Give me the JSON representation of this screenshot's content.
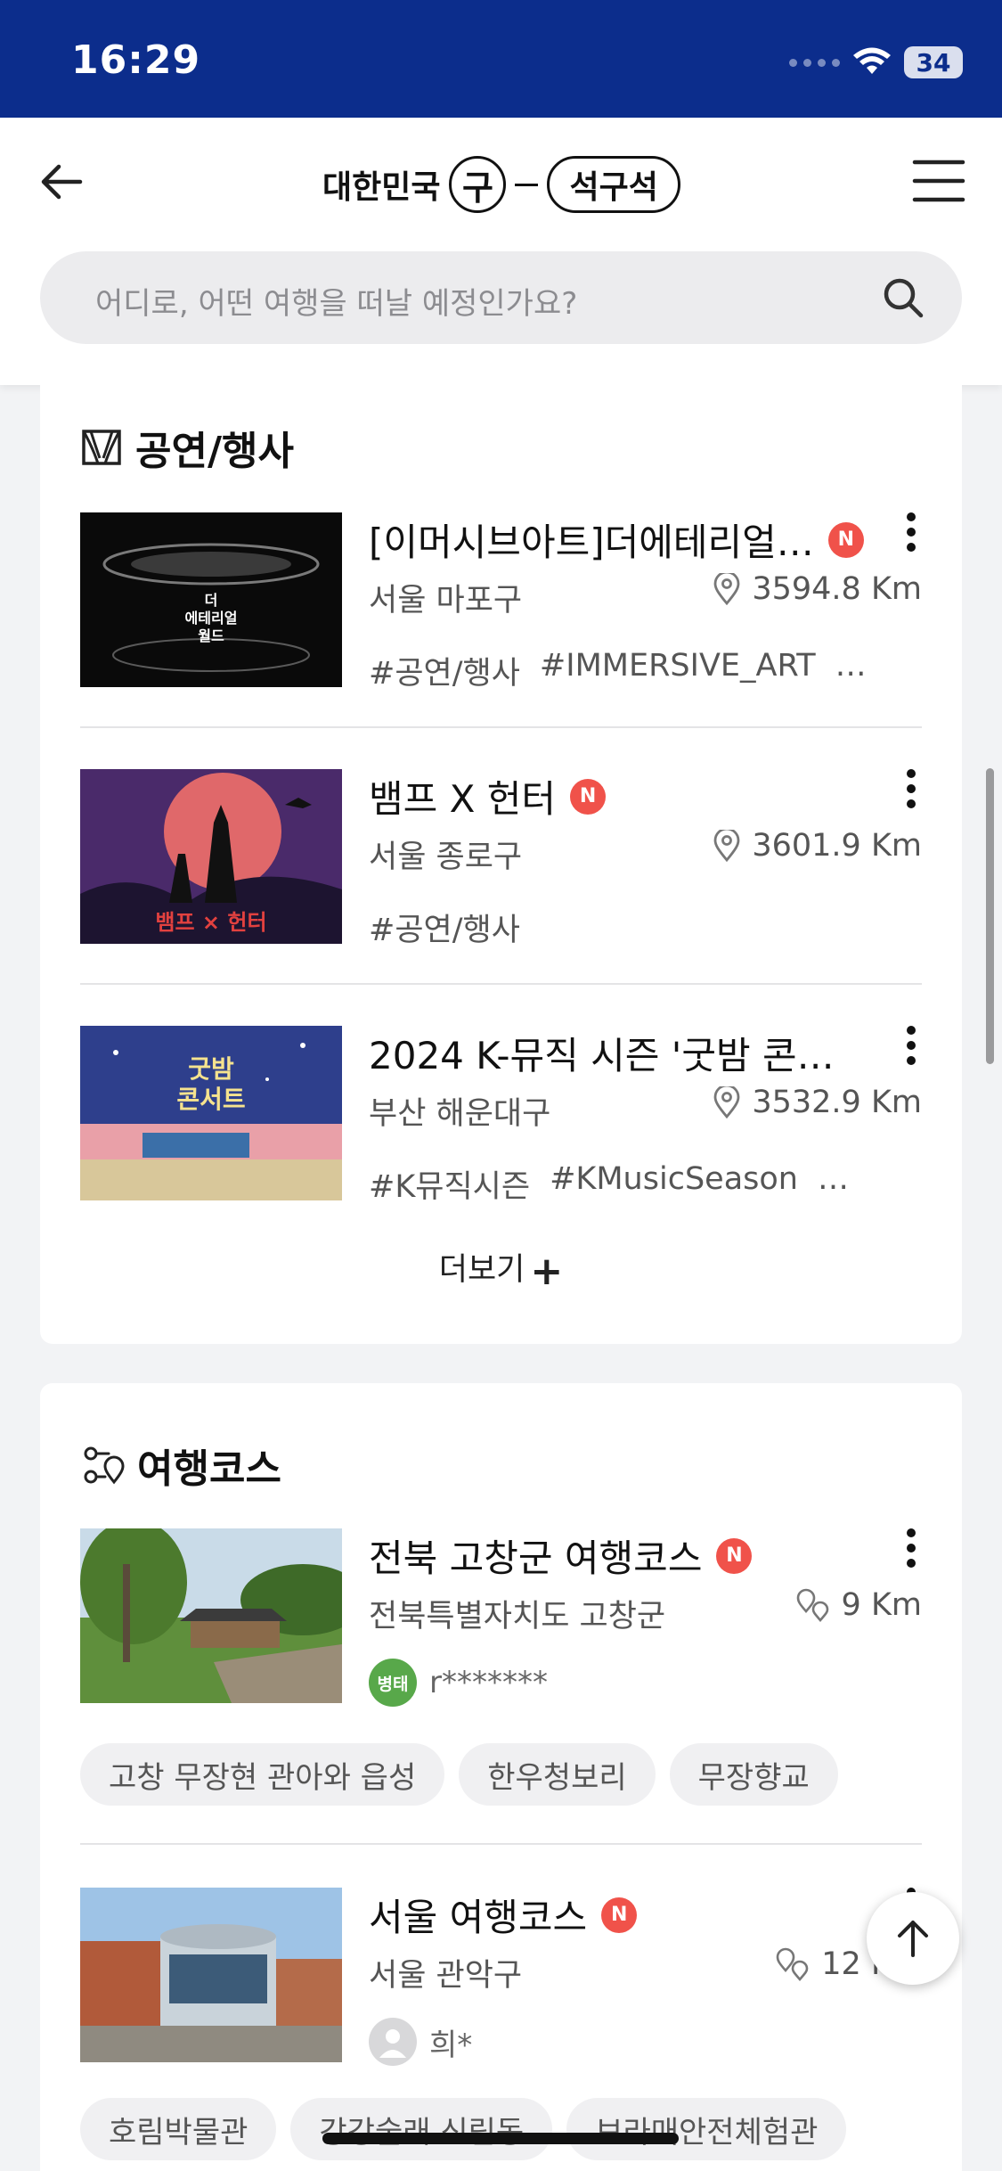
{
  "status_bar": {
    "time": "16:29",
    "battery": "34"
  },
  "header": {
    "logo_prefix": "대한민국",
    "logo_circle": "구",
    "logo_pill": "석구석",
    "search_placeholder": "어디로, 어떤 여행을 떠날 예정인가요?"
  },
  "events": {
    "title": "공연/행사",
    "items": [
      {
        "title": "[이머시브아트]더에테리얼…",
        "badge": "N",
        "location": "서울 마포구",
        "distance": "3594.8 Km",
        "tags": [
          "#공연/행사",
          "#IMMERSIVE_ART",
          "…"
        ],
        "thumb_text": "더\n에테리얼\n월드"
      },
      {
        "title": "뱀프 X 헌터",
        "badge": "N",
        "location": "서울 종로구",
        "distance": "3601.9 Km",
        "tags": [
          "#공연/행사"
        ],
        "thumb_text": "뱀프 × 헌터"
      },
      {
        "title": "2024 K-뮤직 시즌 '굿밤 콘서…",
        "badge": "",
        "location": "부산 해운대구",
        "distance": "3532.9 Km",
        "tags": [
          "#K뮤직시즌",
          "#KMusicSeason",
          "…"
        ],
        "thumb_text": "굿밤\n콘서트"
      }
    ],
    "more_label": "더보기",
    "more_symbol": "+"
  },
  "courses": {
    "title": "여행코스",
    "items": [
      {
        "title": "전북 고창군 여행코스",
        "badge": "N",
        "location": "전북특별자치도 고창군",
        "distance": "9 Km",
        "avatar_text": "병태",
        "username": "r*******",
        "chips": [
          "고창 무장현 관아와 읍성",
          "한우청보리",
          "무장향교"
        ]
      },
      {
        "title": "서울 여행코스",
        "badge": "N",
        "location": "서울 관악구",
        "distance": "12 Km",
        "avatar_text": "",
        "username": "희*",
        "chips": [
          "호림박물관",
          "강강술래 신림동",
          "보라매안전체험관"
        ]
      }
    ]
  },
  "colors": {
    "status_bar": "#0c2d8c",
    "new_badge": "#f0524a",
    "avatar_green": "#58a84a"
  },
  "icons": {
    "back": "arrow-left-icon",
    "menu": "hamburger-icon",
    "search": "search-icon",
    "pin": "map-pin-icon",
    "route": "route-pin-icon",
    "top": "arrow-up-icon"
  }
}
